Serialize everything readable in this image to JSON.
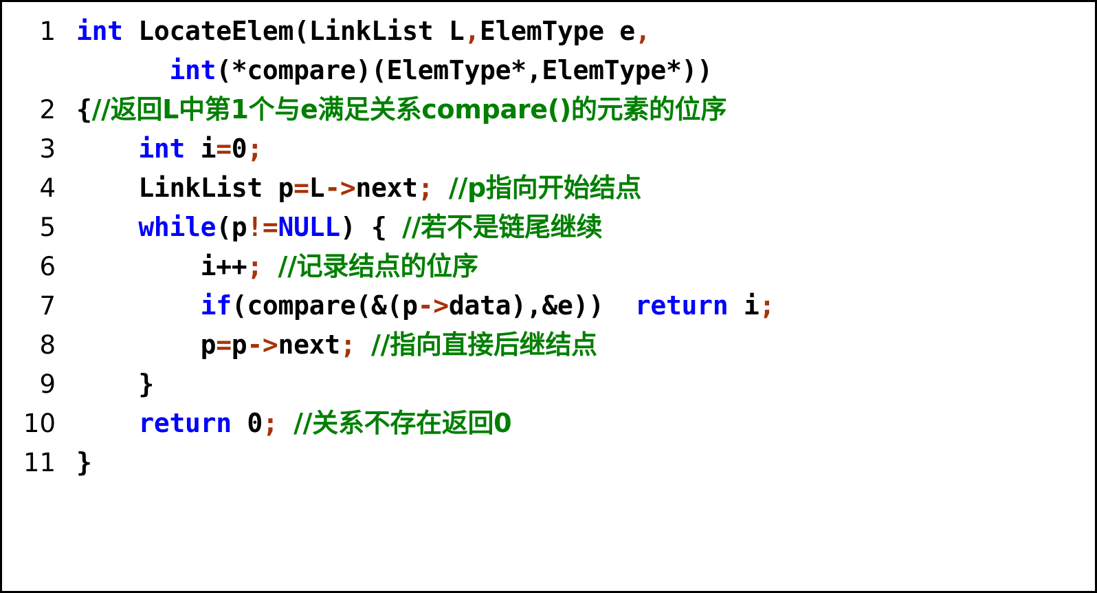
{
  "card": {
    "title": "LocateElem code listing",
    "language": "C",
    "background_color": "#ffffff",
    "border_color": "#000000"
  },
  "syntax_colors": {
    "keyword": "#0000ff",
    "operator": "#a83208",
    "comment": "#007f00",
    "plain": "#000000",
    "line_number": "#000000"
  },
  "code": {
    "lines": [
      {
        "number": "1",
        "indent": "",
        "tokens": [
          {
            "t": "int",
            "k": "kw"
          },
          {
            "t": " LocateElem(LinkList L",
            "k": "plain"
          },
          {
            "t": ",",
            "k": "op"
          },
          {
            "t": "ElemType e",
            "k": "plain"
          },
          {
            "t": ",",
            "k": "op"
          }
        ]
      },
      {
        "number": "",
        "indent": "      ",
        "tokens": [
          {
            "t": "int",
            "k": "kw"
          },
          {
            "t": "(*compare)(ElemType*,ElemType*))",
            "k": "plain"
          }
        ]
      },
      {
        "number": "2",
        "indent": "",
        "tokens": [
          {
            "t": "{",
            "k": "plain"
          },
          {
            "t": "//返回L中第1个与e满足关系compare()的元素的位序",
            "k": "cmt"
          }
        ]
      },
      {
        "number": "3",
        "indent": "    ",
        "tokens": [
          {
            "t": "int",
            "k": "kw"
          },
          {
            "t": " i",
            "k": "plain"
          },
          {
            "t": "=",
            "k": "op"
          },
          {
            "t": "0",
            "k": "num"
          },
          {
            "t": ";",
            "k": "op"
          }
        ]
      },
      {
        "number": "4",
        "indent": "    ",
        "tokens": [
          {
            "t": "LinkList p",
            "k": "plain"
          },
          {
            "t": "=",
            "k": "op"
          },
          {
            "t": "L",
            "k": "plain"
          },
          {
            "t": "->",
            "k": "op"
          },
          {
            "t": "next",
            "k": "plain"
          },
          {
            "t": ";",
            "k": "op"
          },
          {
            "t": " ",
            "k": "plain"
          },
          {
            "t": "//p指向开始结点",
            "k": "cmt"
          }
        ]
      },
      {
        "number": "5",
        "indent": "    ",
        "tokens": [
          {
            "t": "while",
            "k": "kw"
          },
          {
            "t": "(p",
            "k": "plain"
          },
          {
            "t": "!=",
            "k": "op"
          },
          {
            "t": "NULL",
            "k": "kw"
          },
          {
            "t": ") { ",
            "k": "plain"
          },
          {
            "t": "//若不是链尾继续",
            "k": "cmt"
          }
        ]
      },
      {
        "number": "6",
        "indent": "        ",
        "tokens": [
          {
            "t": "i++",
            "k": "plain"
          },
          {
            "t": ";",
            "k": "op"
          },
          {
            "t": " ",
            "k": "plain"
          },
          {
            "t": "//记录结点的位序",
            "k": "cmt"
          }
        ]
      },
      {
        "number": "7",
        "indent": "        ",
        "tokens": [
          {
            "t": "if",
            "k": "kw"
          },
          {
            "t": "(compare(&(p",
            "k": "plain"
          },
          {
            "t": "->",
            "k": "op"
          },
          {
            "t": "data),&e))  ",
            "k": "plain"
          },
          {
            "t": "return",
            "k": "kw"
          },
          {
            "t": " i",
            "k": "plain"
          },
          {
            "t": ";",
            "k": "op"
          }
        ]
      },
      {
        "number": "8",
        "indent": "        ",
        "tokens": [
          {
            "t": "p",
            "k": "plain"
          },
          {
            "t": "=",
            "k": "op"
          },
          {
            "t": "p",
            "k": "plain"
          },
          {
            "t": "->",
            "k": "op"
          },
          {
            "t": "next",
            "k": "plain"
          },
          {
            "t": ";",
            "k": "op"
          },
          {
            "t": " ",
            "k": "plain"
          },
          {
            "t": "//指向直接后继结点",
            "k": "cmt"
          }
        ]
      },
      {
        "number": "9",
        "indent": "    ",
        "tokens": [
          {
            "t": "}",
            "k": "plain"
          }
        ]
      },
      {
        "number": "10",
        "indent": "    ",
        "tokens": [
          {
            "t": "return",
            "k": "kw"
          },
          {
            "t": " ",
            "k": "plain"
          },
          {
            "t": "0",
            "k": "num"
          },
          {
            "t": ";",
            "k": "op"
          },
          {
            "t": " ",
            "k": "plain"
          },
          {
            "t": "//关系不存在返回0",
            "k": "cmt"
          }
        ]
      },
      {
        "number": "11",
        "indent": "",
        "tokens": [
          {
            "t": "}",
            "k": "plain"
          }
        ]
      }
    ]
  }
}
